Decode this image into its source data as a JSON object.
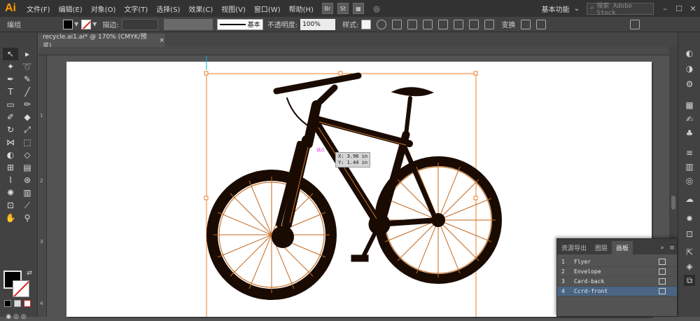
{
  "app": {
    "logo": "Ai",
    "menus": [
      "文件(F)",
      "编辑(E)",
      "对象(O)",
      "文字(T)",
      "选择(S)",
      "效果(C)",
      "视图(V)",
      "窗口(W)",
      "帮助(H)"
    ],
    "bridge": "Br",
    "stock": "St",
    "workspace": "基本功能",
    "search_placeholder": "搜索 Adobe Stock"
  },
  "control": {
    "selection_label": "编组",
    "stroke_label": "描边:",
    "line_style": "基本",
    "opacity_label": "不透明度:",
    "opacity_value": "100%",
    "style_label": "样式:",
    "transform_label": "变换"
  },
  "document": {
    "tab_title": "recycle.ai1.ai* @ 170% (CMYK/预览)",
    "close": "×"
  },
  "rulers": {
    "left_marks": [
      "1",
      "2",
      "3",
      "4"
    ]
  },
  "canvas": {
    "coord_x": "X: 3.96 in",
    "coord_y": "Y: 1.44 in",
    "anchor_label": "锚点"
  },
  "artboards_panel": {
    "tabs": [
      "资源导出",
      "图层",
      "画板"
    ],
    "rows": [
      {
        "num": "1",
        "name": "Flyer"
      },
      {
        "num": "2",
        "name": "Envelope"
      },
      {
        "num": "3",
        "name": "Card-back"
      },
      {
        "num": "4",
        "name": "Ccrd-front"
      }
    ],
    "selected_index": 3
  }
}
